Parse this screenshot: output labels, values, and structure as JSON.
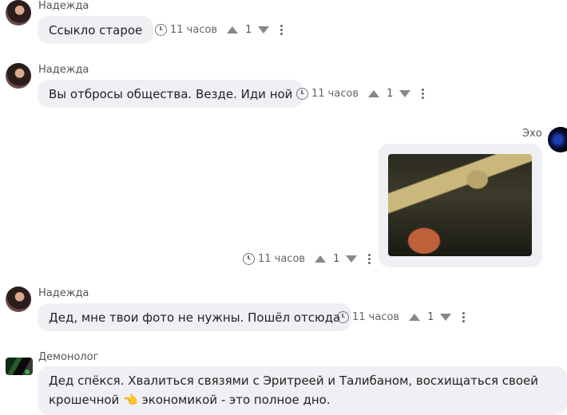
{
  "messages": [
    {
      "author": "Надежда",
      "text": "Ссыкло старое",
      "time": "11 часов",
      "score": "1"
    },
    {
      "author": "Надежда",
      "text": "Вы отбросы общества. Везде. Иди ной",
      "time": "11 часов",
      "score": "1"
    },
    {
      "author": "Эхо",
      "media": "image",
      "time": "11 часов",
      "score": "1"
    },
    {
      "author": "Надежда",
      "text": "Дед, мне твои фото не нужны. Пошёл отсюда",
      "time": "11 часов",
      "score": "1"
    },
    {
      "author": "Демонолог",
      "text_part1": "Дед спёкся. Хвалиться связями с Эритреей и Талибаном, восхищаться своей крошечной",
      "emoji": "👈",
      "text_part2": "экономикой - это полное дно."
    }
  ],
  "colors": {
    "bubble": "#eef0f3",
    "online": "#35b34a",
    "meta": "#666666"
  },
  "icons": [
    "clock-icon",
    "upvote-icon",
    "downvote-icon",
    "more-icon"
  ]
}
